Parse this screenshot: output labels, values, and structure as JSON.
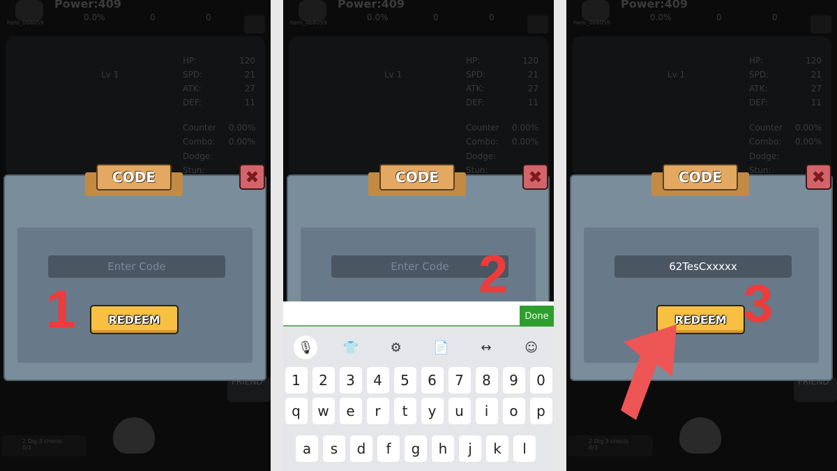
{
  "game": {
    "power": "Power:409",
    "hero_id": "hero_068059",
    "rate": "0.0%",
    "gold": "0",
    "gems": "0",
    "level": "Lv 1",
    "stats": [
      {
        "label": "HP:",
        "value": "120"
      },
      {
        "label": "SPD:",
        "value": "21"
      },
      {
        "label": "ATK:",
        "value": "27"
      },
      {
        "label": "DEF:",
        "value": "11"
      },
      {
        "label": "Counter",
        "value": "0.00%"
      },
      {
        "label": "Combo:",
        "value": "0.00%"
      },
      {
        "label": "Dodge:",
        "value": ""
      },
      {
        "label": "Stun:",
        "value": ""
      }
    ],
    "friend": "FRIEND",
    "quest": "2 Dig 3 chests",
    "quest_progress": "0/3"
  },
  "dialog": {
    "title": "CODE",
    "close_icon": "close-x-icon",
    "placeholder": "Enter Code",
    "redeem_label": "REDEEM"
  },
  "panels": [
    {
      "step": "1",
      "input_value": "",
      "keyboard": false,
      "arrow": false
    },
    {
      "step": "2",
      "input_value": "",
      "keyboard": true,
      "arrow": false
    },
    {
      "step": "3",
      "input_value": "62TesCxxxxx",
      "keyboard": false,
      "arrow": true
    }
  ],
  "keyboard": {
    "done_label": "Done",
    "toolbar_icons": [
      "microphone-icon",
      "tshirt-icon",
      "gear-icon",
      "clipboard-icon",
      "cursor-move-icon",
      "emoji-icon"
    ],
    "rows": [
      [
        "1",
        "2",
        "3",
        "4",
        "5",
        "6",
        "7",
        "8",
        "9",
        "0"
      ],
      [
        "q",
        "w",
        "e",
        "r",
        "t",
        "y",
        "u",
        "i",
        "o",
        "p"
      ],
      [
        "a",
        "s",
        "d",
        "f",
        "g",
        "h",
        "j",
        "k",
        "l"
      ]
    ]
  },
  "colors": {
    "step_number": "#ee3b3b",
    "redeem": "#f7c043",
    "done": "#2f9e2f",
    "dialog": "#7a8d9b"
  }
}
